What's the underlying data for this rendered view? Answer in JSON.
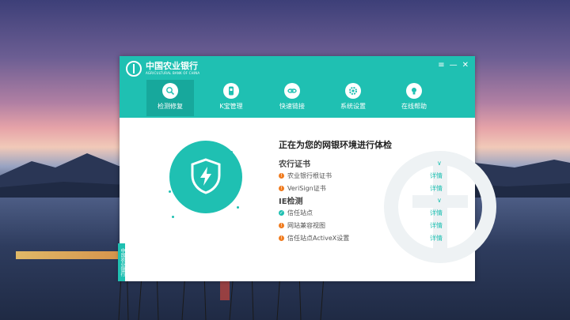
{
  "window": {
    "logo_cn": "中国农业银行",
    "logo_en": "AGRICULTURAL BANK OF CHINA",
    "controls": {
      "menu": "≡",
      "minimize": "—",
      "close": "✕"
    }
  },
  "nav": {
    "items": [
      {
        "label": "检测修复",
        "icon": "search-shield-icon"
      },
      {
        "label": "K宝管理",
        "icon": "usb-key-icon"
      },
      {
        "label": "快速链接",
        "icon": "link-icon"
      },
      {
        "label": "系统设置",
        "icon": "gear-icon"
      },
      {
        "label": "在线帮助",
        "icon": "lightbulb-icon"
      }
    ]
  },
  "side_tab": "中国农业银行",
  "check": {
    "title": "正在为您的网银环境进行体检",
    "sections": [
      {
        "name": "农行证书",
        "items": [
          {
            "label": "农业银行根证书",
            "status": "warn",
            "detail": "详情"
          },
          {
            "label": "VeriSign证书",
            "status": "warn",
            "detail": "详情"
          }
        ]
      },
      {
        "name": "IE检测",
        "items": [
          {
            "label": "信任站点",
            "status": "ok",
            "detail": "详情"
          },
          {
            "label": "网站兼容视图",
            "status": "warn",
            "detail": "详情"
          },
          {
            "label": "信任站点ActiveX设置",
            "status": "warn",
            "detail": "详情"
          }
        ]
      }
    ]
  },
  "colors": {
    "accent": "#1fc0b2",
    "accent_dark": "#17a89c",
    "warn": "#f07b1e"
  }
}
